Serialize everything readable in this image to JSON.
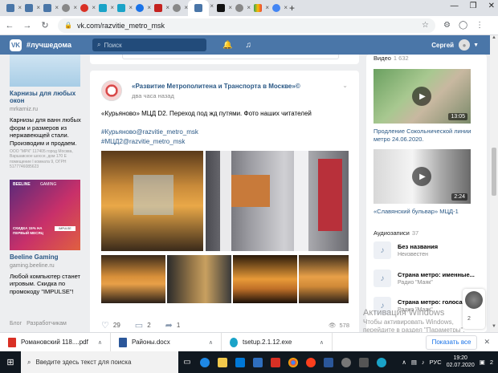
{
  "browser": {
    "tabs": [
      {
        "icon": "vk-icon",
        "color": "#4a76a8"
      },
      {
        "icon": "vk-icon",
        "color": "#4a76a8"
      },
      {
        "icon": "vk-icon",
        "color": "#4a76a8"
      },
      {
        "icon": "globe-icon",
        "color": "#888888"
      },
      {
        "icon": "red-circle-icon",
        "color": "#d93025"
      },
      {
        "icon": "bookmark-icon",
        "color": "#1aa3c8"
      },
      {
        "icon": "bookmark-icon",
        "color": "#1aa3c8"
      },
      {
        "icon": "pin-icon",
        "color": "#1a73e8"
      },
      {
        "icon": "red-square-icon",
        "color": "#c5221f"
      },
      {
        "icon": "globe-icon",
        "color": "#888888"
      },
      {
        "icon": "vk-icon",
        "color": "#4a76a8",
        "active": true
      },
      {
        "icon": "m-icon",
        "color": "#111111"
      },
      {
        "icon": "globe-icon",
        "color": "#888888"
      },
      {
        "icon": "colorful-icon",
        "color": "#34a853"
      },
      {
        "icon": "google-icon",
        "color": "#4285f4"
      }
    ],
    "new_tab": "+",
    "url": "vk.com/razvitie_metro_msk"
  },
  "vk_header": {
    "tag": "#лучшедома",
    "search_placeholder": "Поиск",
    "user_name": "Сергей"
  },
  "left_ads": {
    "ad1": {
      "title": "Карнизы для любых окон",
      "domain": "mrkarniz.ru",
      "text": "Карнизы для ванн любых форм и размеров из нержавеющей стали. Производим и продаем.",
      "legal": "ООО \"МРК\" 117405 город Москва, Варшавское шоссе, дом 170 Е помещение I комната 9, ОГРН 5177746085623"
    },
    "ad2": {
      "brand": "BEELINE",
      "brand2": "GAMING",
      "promo": "СКИДКА 15% НА ПЕРВЫЙ МЕСЯЦ",
      "cta": "IMPULSE",
      "title": "Beeline Gaming",
      "domain": "gaming.beeline.ru",
      "text": "Любой компьютер станет игровым. Скидка по промокоду \"IMPULSE\"!"
    },
    "footer": [
      "Блог",
      "Разработчикам"
    ]
  },
  "post": {
    "author": "«Развитие Метрополитена и Транспорта в Москве»©",
    "time": "два часа назад",
    "text": "«Курьяново» МЦД D2. Переход под жд путями. Фото наших читателей",
    "tag1": "#Курьяново@razvitie_metro_msk",
    "tag2": "#МЦД2@razvitie_metro_msk",
    "likes": "29",
    "comments": "2",
    "shares": "1",
    "views": "578"
  },
  "right_col": {
    "video_head": "Видео",
    "video_count": "1 632",
    "videos": [
      {
        "title": "Продление Сокольнической линии метро 24.06.2020.",
        "duration": "13:05"
      },
      {
        "title": "«Славянский бульвар» МЦД-1",
        "duration": "2:24"
      }
    ],
    "audio_head": "Аудиозаписи",
    "audio_count": "37",
    "tracks": [
      {
        "title": "Без названия",
        "artist": "Неизвестен"
      },
      {
        "title": "Страна метро: именные...",
        "artist": "Радио \"Маяк\""
      },
      {
        "title": "Страна метро: голоса...",
        "artist": "Радио \"Маяк\""
      }
    ],
    "float_count": "2"
  },
  "watermark": {
    "line1": "Активация Windows",
    "line2": "Чтобы активировать Windows,",
    "line3": "перейдите в раздел \"Параметры\"."
  },
  "downloads": {
    "items": [
      {
        "name": "Романовский 118....pdf",
        "color": "#d93025"
      },
      {
        "name": "Районы.docx",
        "color": "#2b579a"
      },
      {
        "name": "tsetup.2.1.12.exe",
        "color": "#1aa3c8"
      }
    ],
    "show_all": "Показать все"
  },
  "taskbar": {
    "search_placeholder": "Введите здесь текст для поиска",
    "lang": "РУС",
    "time": "19:20",
    "date": "02.07.2020",
    "notif": "2"
  }
}
